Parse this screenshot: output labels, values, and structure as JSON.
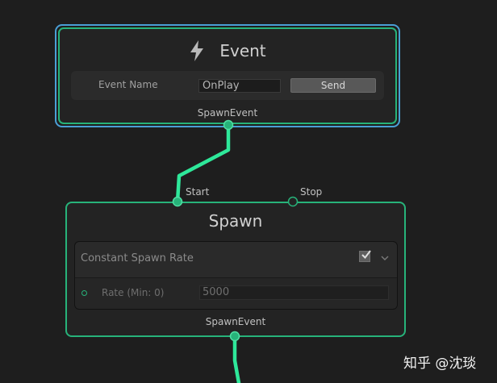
{
  "event_node": {
    "title": "Event",
    "icon": "lightning-bolt-icon",
    "field_label": "Event Name",
    "field_value": "OnPlay",
    "send_label": "Send",
    "output_label": "SpawnEvent"
  },
  "spawn_node": {
    "title": "Spawn",
    "input_start_label": "Start",
    "input_stop_label": "Stop",
    "block": {
      "title": "Constant Spawn Rate",
      "enabled": true,
      "property_label": "Rate (Min: 0)",
      "property_value": "5000"
    },
    "output_label": "SpawnEvent"
  },
  "watermark": "知乎 @沈琰",
  "colors": {
    "background": "#1e1e1e",
    "node_border_green": "#27b37a",
    "selected_border_blue": "#4a9fd6",
    "edge_green": "#2ee89a"
  }
}
